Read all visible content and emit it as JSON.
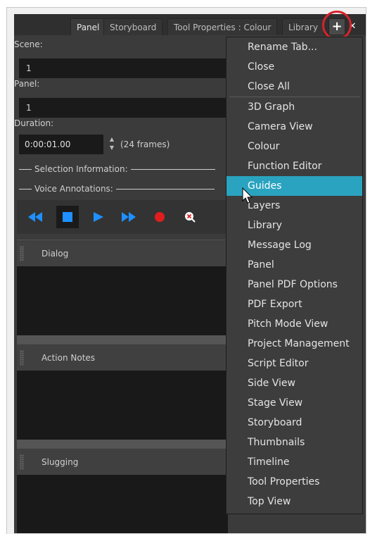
{
  "tabs": [
    {
      "label": "Panel",
      "active": true
    },
    {
      "label": "Storyboard",
      "active": false
    },
    {
      "label": "Tool Properties : Colour",
      "active": false
    },
    {
      "label": "Library",
      "active": false
    }
  ],
  "tab_controls": {
    "add_glyph": "+",
    "close_glyph": "✕"
  },
  "fields": {
    "scene_label": "Scene:",
    "scene_value": "1",
    "panel_label": "Panel:",
    "panel_value": "1",
    "duration_label": "Duration:",
    "duration_value": "0:00:01.00",
    "frames_text": "(24 frames)"
  },
  "sections": {
    "selection_info": "Selection Information:",
    "voice_annotations": "Voice Annotations:"
  },
  "voice_buttons": [
    "rewind-icon",
    "stop-icon",
    "play-icon",
    "fast-forward-icon",
    "record-icon",
    "delete-sound-icon"
  ],
  "panels": [
    {
      "title": "Dialog"
    },
    {
      "title": "Action Notes"
    },
    {
      "title": "Slugging"
    }
  ],
  "context_menu": {
    "top_items": [
      "Rename Tab...",
      "Close",
      "Close All"
    ],
    "view_items": [
      "3D Graph",
      "Camera View",
      "Colour",
      "Function Editor",
      "Guides",
      "Layers",
      "Library",
      "Message Log",
      "Panel",
      "Panel PDF Options",
      "PDF Export",
      "Pitch Mode View",
      "Project Management",
      "Script Editor",
      "Side View",
      "Stage View",
      "Storyboard",
      "Thumbnails",
      "Timeline",
      "Tool Properties",
      "Top View"
    ],
    "highlighted": "Guides"
  },
  "colors": {
    "highlight": "#2aa3c0",
    "annotation_ring": "#d8232a",
    "playback_blue": "#1e90ff",
    "record_red": "#e01e1e"
  }
}
